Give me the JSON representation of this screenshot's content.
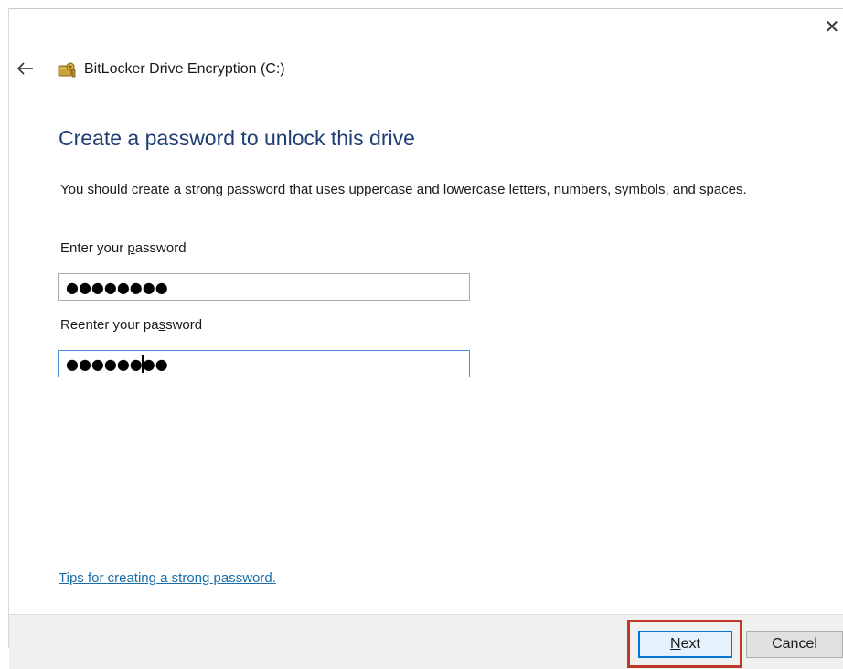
{
  "window": {
    "close_glyph": "✕",
    "back_icon": "back-arrow-icon",
    "app_icon": "bitlocker-key-icon",
    "title": "BitLocker Drive Encryption (C:)"
  },
  "main": {
    "heading": "Create a password to unlock this drive",
    "description": "You should create a strong password that uses uppercase and lowercase letters, numbers, symbols, and spaces.",
    "password_label_pre": "Enter your ",
    "password_label_acc": "p",
    "password_label_post": "assword",
    "password_value": "●●●●●●●●",
    "reenter_label_pre": "Reenter your pa",
    "reenter_label_acc": "s",
    "reenter_label_post": "sword",
    "reenter_value": "●●●●●●●●",
    "tips_link": "Tips for creating a strong password."
  },
  "footer": {
    "next_acc": "N",
    "next_rest": "ext",
    "cancel_label": "Cancel"
  },
  "colors": {
    "heading": "#1f3e73",
    "link": "#1a6ea8",
    "highlight": "#c0392b",
    "focus": "#0078d7"
  }
}
